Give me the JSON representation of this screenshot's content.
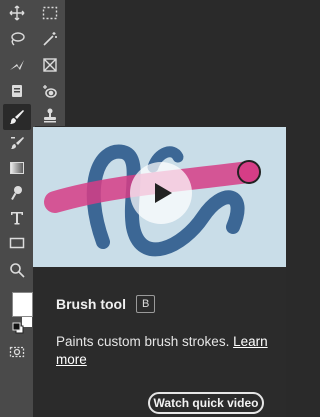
{
  "toolbar": {
    "tools": [
      {
        "name": "move-tool",
        "icon": "move-icon",
        "active": false
      },
      {
        "name": "marquee-tool",
        "icon": "marquee-icon",
        "active": false
      },
      {
        "name": "lasso-tool",
        "icon": "lasso-icon",
        "active": false
      },
      {
        "name": "magic-wand-tool",
        "icon": "magic-wand-icon",
        "active": false
      },
      {
        "name": "crop-tool",
        "icon": "crop-icon",
        "active": false
      },
      {
        "name": "frame-tool",
        "icon": "frame-icon",
        "active": false
      },
      {
        "name": "eyedropper-tool",
        "icon": "eyedropper-icon",
        "active": false
      },
      {
        "name": "spot-healing-tool",
        "icon": "spot-healing-icon",
        "active": false
      },
      {
        "name": "brush-tool",
        "icon": "brush-icon",
        "active": true
      },
      {
        "name": "clone-stamp-tool",
        "icon": "stamp-icon",
        "active": false
      },
      {
        "name": "history-brush-tool",
        "icon": "history-brush-icon",
        "active": false
      },
      {
        "name": "gradient-tool",
        "icon": "gradient-icon",
        "active": false
      },
      {
        "name": "dodge-tool",
        "icon": "dodge-icon",
        "active": false
      },
      {
        "name": "type-tool",
        "icon": "type-icon",
        "active": false
      },
      {
        "name": "rectangle-tool",
        "icon": "rectangle-icon",
        "active": false
      },
      {
        "name": "zoom-tool",
        "icon": "zoom-icon",
        "active": false
      },
      {
        "name": "quick-mask",
        "icon": "quick-mask-icon",
        "active": false
      }
    ],
    "foreground_color": "#ffffff",
    "background_color": "#ffffff"
  },
  "tooltip": {
    "title": "Brush tool",
    "shortcut": "B",
    "description": "Paints custom brush strokes.",
    "learn_more": "Learn more",
    "watch_button": "Watch quick video",
    "preview_bg": "#c9dde8",
    "stroke_blue": "#2c5a8c",
    "stroke_pink": "#d63d86"
  }
}
